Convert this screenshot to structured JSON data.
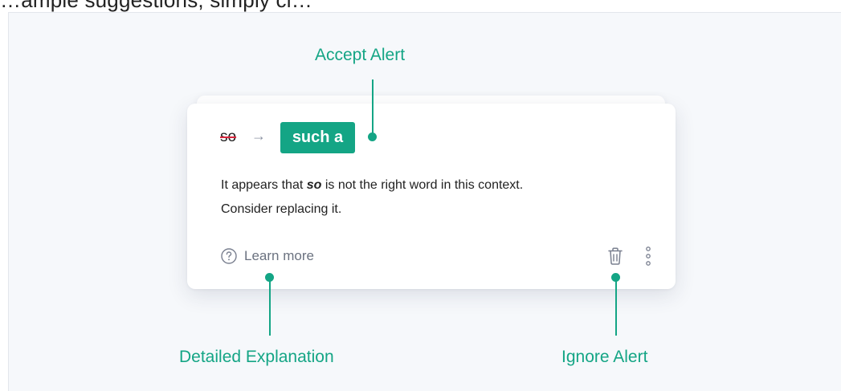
{
  "header": {
    "text": "…ample suggestions, simply cl…"
  },
  "card": {
    "original_word": "so",
    "arrow": "→",
    "replacement": "such a",
    "message_part1": "It appears that ",
    "message_bold": "so",
    "message_part2": " is not the right word in this context.",
    "message_line2": "Consider replacing it.",
    "learn_more": "Learn more"
  },
  "callouts": {
    "accept": "Accept Alert",
    "explanation": "Detailed Explanation",
    "ignore": "Ignore Alert"
  },
  "colors": {
    "accent": "#14a585",
    "panel_bg": "#f6f8fb",
    "strike": "#d9263e"
  },
  "icons": {
    "help": "question-circle-icon",
    "trash": "trash-icon",
    "more": "vertical-dots-icon"
  }
}
